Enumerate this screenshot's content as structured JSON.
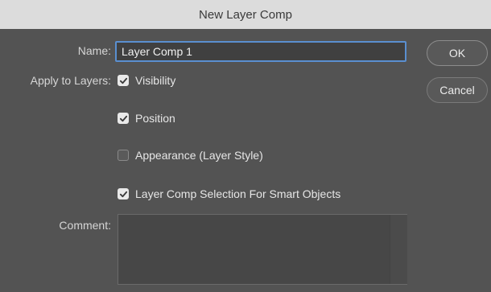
{
  "dialog": {
    "title": "New Layer Comp"
  },
  "form": {
    "name_label": "Name:",
    "name_value": "Layer Comp 1",
    "apply_label": "Apply to Layers:",
    "options": [
      {
        "label": "Visibility",
        "checked": true
      },
      {
        "label": "Position",
        "checked": true
      },
      {
        "label": "Appearance (Layer Style)",
        "checked": false
      },
      {
        "label": "Layer Comp Selection For Smart Objects",
        "checked": true
      }
    ],
    "comment_label": "Comment:",
    "comment_value": ""
  },
  "buttons": {
    "ok_label": "OK",
    "cancel_label": "Cancel"
  },
  "colors": {
    "background": "#535353",
    "focus_ring": "#5a8fd0"
  },
  "icons": {
    "checkmark": "checkmark-icon"
  }
}
